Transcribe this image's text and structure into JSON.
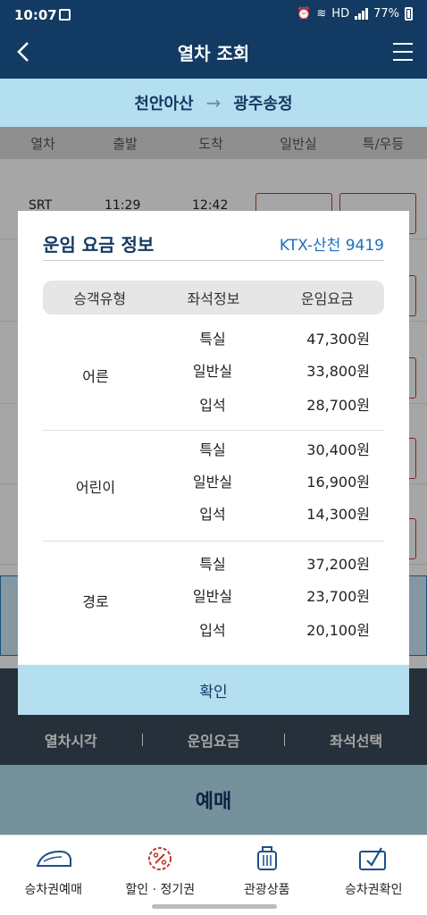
{
  "status": {
    "time": "10:07",
    "battery": "77%",
    "network": "HD"
  },
  "header": {
    "title": "열차 조회"
  },
  "route": {
    "from": "천안아산",
    "arrow": "→",
    "to": "광주송정"
  },
  "columns": [
    "열차",
    "출발",
    "도착",
    "일반실",
    "특/우등"
  ],
  "list": {
    "first_row": {
      "train": "SRT",
      "depart": "11:29",
      "arrive": "12:42"
    }
  },
  "tabs": [
    "열차시각",
    "운임요금",
    "좌석선택"
  ],
  "book_button": "예매",
  "bottom_nav": [
    {
      "label": "승차권예매",
      "icon": "ktx-train-icon"
    },
    {
      "label": "할인 · 정기권",
      "icon": "discount-badge-icon"
    },
    {
      "label": "관광상품",
      "icon": "luggage-icon"
    },
    {
      "label": "승차권확인",
      "icon": "ticket-check-icon"
    }
  ],
  "modal": {
    "title": "운임 요금 정보",
    "train": "KTX-산천 9419",
    "headers": [
      "승객유형",
      "좌석정보",
      "운임요금"
    ],
    "groups": [
      {
        "type": "어른",
        "rows": [
          {
            "seat": "특실",
            "price": "47,300원"
          },
          {
            "seat": "일반실",
            "price": "33,800원"
          },
          {
            "seat": "입석",
            "price": "28,700원"
          }
        ]
      },
      {
        "type": "어린이",
        "rows": [
          {
            "seat": "특실",
            "price": "30,400원"
          },
          {
            "seat": "일반실",
            "price": "16,900원"
          },
          {
            "seat": "입석",
            "price": "14,300원"
          }
        ]
      },
      {
        "type": "경로",
        "rows": [
          {
            "seat": "특실",
            "price": "37,200원"
          },
          {
            "seat": "일반실",
            "price": "23,700원"
          },
          {
            "seat": "입석",
            "price": "20,100원"
          }
        ]
      }
    ],
    "confirm": "확인"
  }
}
